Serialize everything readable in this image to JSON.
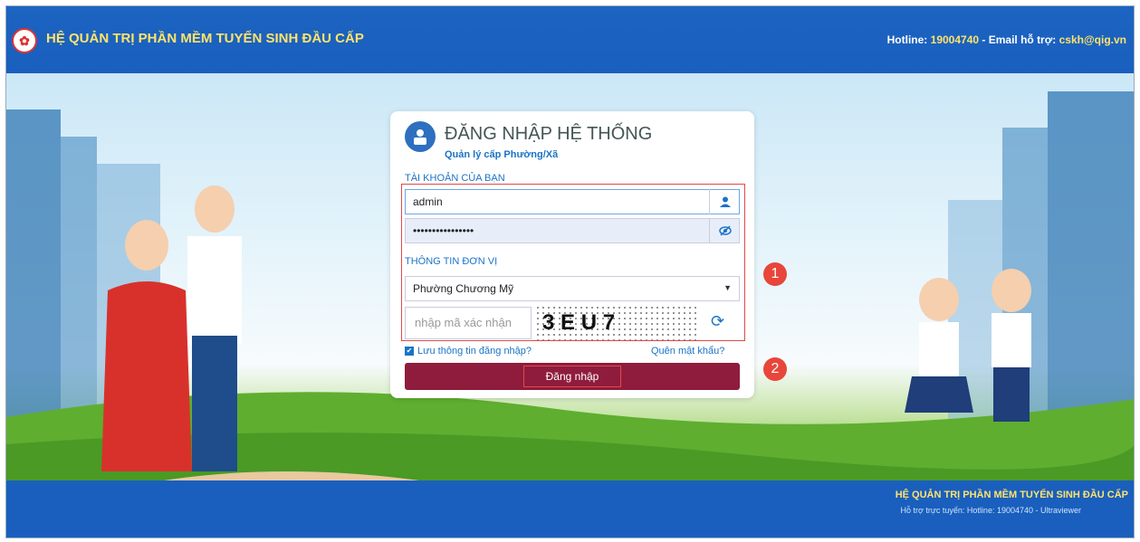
{
  "header": {
    "app_title": "HỆ QUẢN TRỊ PHẦN MỀM TUYỂN SINH ĐẦU CẤP",
    "hotline_label": "Hotline:",
    "hotline_number": "19004740",
    "email_label": "- Email hỗ trợ:",
    "email": "cskh@qig.vn"
  },
  "login": {
    "title": "ĐĂNG NHẬP HỆ THỐNG",
    "subtitle": "Quản lý cấp Phường/Xã",
    "account_section": "TÀI KHOẢN CỦA BẠN",
    "username_value": "admin",
    "password_value": "••••••••••••••••",
    "unit_section": "THÔNG TIN ĐƠN VỊ",
    "unit_selected": "Phường Chương Mỹ",
    "captcha_placeholder": "nhập mã xác nhận",
    "captcha_text": "3 E U 7",
    "remember_label": "Lưu thông tin đăng nhập?",
    "forgot_label": "Quên mật khẩu?",
    "submit_label": "Đăng nhập"
  },
  "annotations": {
    "badge1": "1",
    "badge2": "2"
  },
  "footer": {
    "title": "HỆ QUẢN TRỊ PHẦN MỀM TUYỂN SINH ĐẦU CẤP",
    "support": "Hỗ trợ trực tuyến: Hotline: 19004740 - Ultraviewer"
  },
  "colors": {
    "primary": "#1a5fbd",
    "accent": "#ffe36b",
    "button": "#8f1c3d",
    "highlight": "#e14a4a"
  },
  "icons": [
    "app-logo-icon",
    "user-icon",
    "eye-toggle-icon",
    "refresh-icon",
    "dropdown-caret-icon",
    "login-person-icon"
  ]
}
